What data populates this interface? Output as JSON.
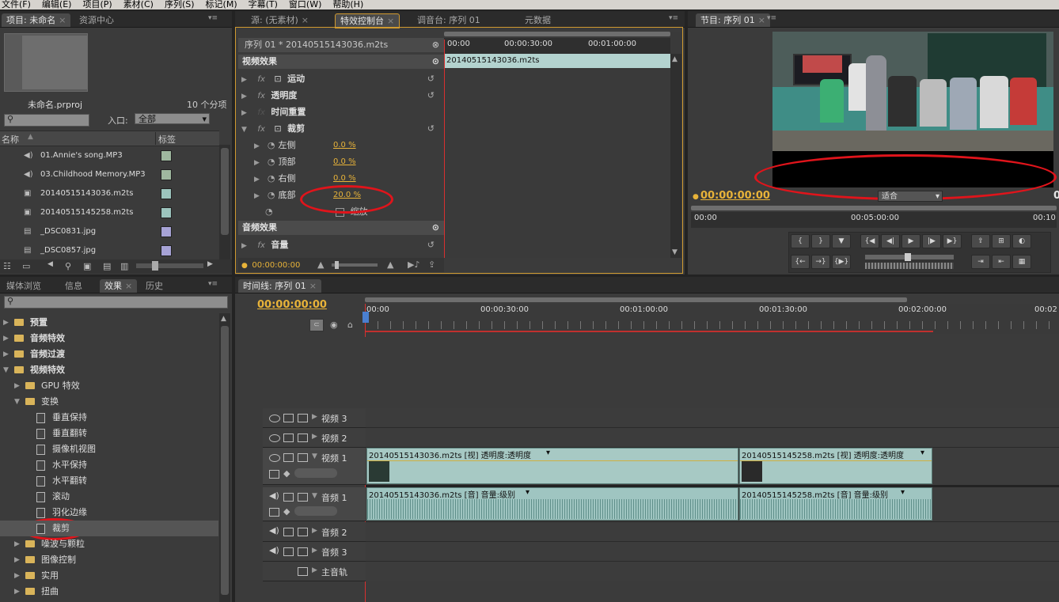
{
  "menu": [
    "文件(F)",
    "编辑(E)",
    "项目(P)",
    "素材(C)",
    "序列(S)",
    "标记(M)",
    "字幕(T)",
    "窗口(W)",
    "帮助(H)"
  ],
  "project_panel": {
    "tabs": [
      "项目: 未命名",
      "资源中心"
    ],
    "project_file": "未命名.prproj",
    "item_count": "10 个分项",
    "search_placeholder": "",
    "in_label": "入口:",
    "in_value": "全部",
    "col_name": "名称",
    "col_label": "标签",
    "items": [
      {
        "name": "01.Annie's song.MP3",
        "type": "audio",
        "color": "#9fb89f"
      },
      {
        "name": "03.Childhood Memory.MP3",
        "type": "audio",
        "color": "#9fb89f"
      },
      {
        "name": "20140515143036.m2ts",
        "type": "video",
        "color": "#9cc4bd"
      },
      {
        "name": "20140515145258.m2ts",
        "type": "video",
        "color": "#9cc4bd"
      },
      {
        "name": "_DSC0831.jpg",
        "type": "image",
        "color": "#a7a3d6"
      },
      {
        "name": "_DSC0857.jpg",
        "type": "image",
        "color": "#a7a3d6"
      }
    ]
  },
  "effect_controls": {
    "tabs": [
      "源: (无素材)",
      "特效控制台",
      "调音台: 序列 01",
      "元数据"
    ],
    "sequence_label": "序列 01 * 20140515143036.m2ts",
    "video_effects": "视频效果",
    "motion": "运动",
    "opacity": "透明度",
    "time_remap": "时间重置",
    "crop": "裁剪",
    "crop_params": [
      {
        "name": "左侧",
        "value": "0.0 %"
      },
      {
        "name": "顶部",
        "value": "0.0 %"
      },
      {
        "name": "右侧",
        "value": "0.0 %"
      },
      {
        "name": "底部",
        "value": "20.0 %"
      }
    ],
    "zoom": "缩放",
    "audio_effects": "音频效果",
    "volume": "音量",
    "timecode": "00:00:00:00",
    "ruler": [
      "00:00",
      "00:00:30:00",
      "00:01:00:00"
    ],
    "clip_name": "20140515143036.m2ts"
  },
  "program_monitor": {
    "tab": "节目: 序列 01",
    "timecode": "00:00:00:00",
    "fit": "适合",
    "ruler": [
      "00:00",
      "00:05:00:00",
      "00:10"
    ],
    "right_tc": "0"
  },
  "effects_panel": {
    "tabs": [
      "媒体浏览",
      "信息",
      "效果",
      "历史"
    ],
    "tree": [
      {
        "label": "预置",
        "level": 0,
        "kind": "folder",
        "bold": true
      },
      {
        "label": "音频特效",
        "level": 0,
        "kind": "folder",
        "bold": true
      },
      {
        "label": "音频过渡",
        "level": 0,
        "kind": "folder",
        "bold": true
      },
      {
        "label": "视频特效",
        "level": 0,
        "kind": "folder",
        "bold": true,
        "open": true
      },
      {
        "label": "GPU 特效",
        "level": 1,
        "kind": "folder"
      },
      {
        "label": "变换",
        "level": 1,
        "kind": "folder",
        "open": true
      },
      {
        "label": "垂直保持",
        "level": 2,
        "kind": "fx"
      },
      {
        "label": "垂直翻转",
        "level": 2,
        "kind": "fx"
      },
      {
        "label": "摄像机视图",
        "level": 2,
        "kind": "fx"
      },
      {
        "label": "水平保持",
        "level": 2,
        "kind": "fx"
      },
      {
        "label": "水平翻转",
        "level": 2,
        "kind": "fx"
      },
      {
        "label": "滚动",
        "level": 2,
        "kind": "fx"
      },
      {
        "label": "羽化边缘",
        "level": 2,
        "kind": "fx"
      },
      {
        "label": "裁剪",
        "level": 2,
        "kind": "fx",
        "selected": true
      },
      {
        "label": "噪波与颗粒",
        "level": 1,
        "kind": "folder"
      },
      {
        "label": "图像控制",
        "level": 1,
        "kind": "folder"
      },
      {
        "label": "实用",
        "level": 1,
        "kind": "folder"
      },
      {
        "label": "扭曲",
        "level": 1,
        "kind": "folder"
      }
    ]
  },
  "timeline": {
    "tab": "时间线: 序列 01",
    "timecode": "00:00:00:00",
    "ruler": [
      "00:00",
      "00:00:30:00",
      "00:01:00:00",
      "00:01:30:00",
      "00:02:00:00",
      "00:02"
    ],
    "tracks": {
      "v3": "视频 3",
      "v2": "视频 2",
      "v1": "视频 1",
      "a1": "音频 1",
      "a2": "音频 2",
      "a3": "音频 3",
      "master": "主音轨"
    },
    "v_clip1": "20140515143036.m2ts  [视]  透明度:透明度",
    "v_clip2": "20140515145258.m2ts  [视]  透明度:透明度",
    "a_clip1": "20140515143036.m2ts  [音]  音量:级别",
    "a_clip2": "20140515145258.m2ts  [音]  音量:级别"
  }
}
